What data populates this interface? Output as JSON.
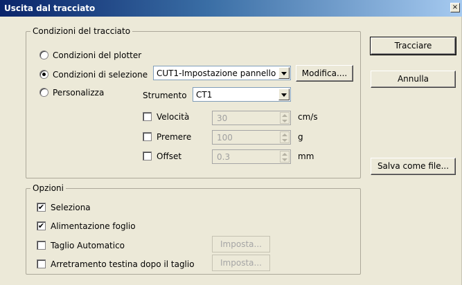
{
  "window": {
    "title": "Uscita dal tracciato",
    "close_glyph": "×"
  },
  "conditions": {
    "title": "Condizioni del tracciato",
    "radio_plotter": "Condizioni del plotter",
    "radio_selection": "Condizioni di selezione",
    "radio_custom": "Personalizza",
    "selection_combo_value": "CUT1-Impostazione pannello",
    "modify_button": "Modifica....",
    "tool_label": "Strumento",
    "tool_value": "CT1",
    "speed_label": "Velocità",
    "speed_value": "30",
    "speed_unit": "cm/s",
    "press_label": "Premere",
    "press_value": "100",
    "press_unit": "g",
    "offset_label": "Offset",
    "offset_value": "0.3",
    "offset_unit": "mm"
  },
  "options": {
    "title": "Opzioni",
    "select_label": "Seleziona",
    "feed_label": "Alimentazione foglio",
    "auto_cut_label": "Taglio Automatico",
    "retract_label": "Arretramento testina dopo il taglio",
    "set_button": "Imposta...",
    "set_button_2": "Imposta...",
    "check_mark": "✔"
  },
  "buttons": {
    "plot": "Tracciare",
    "cancel": "Annulla",
    "save_file": "Salva come file..."
  }
}
